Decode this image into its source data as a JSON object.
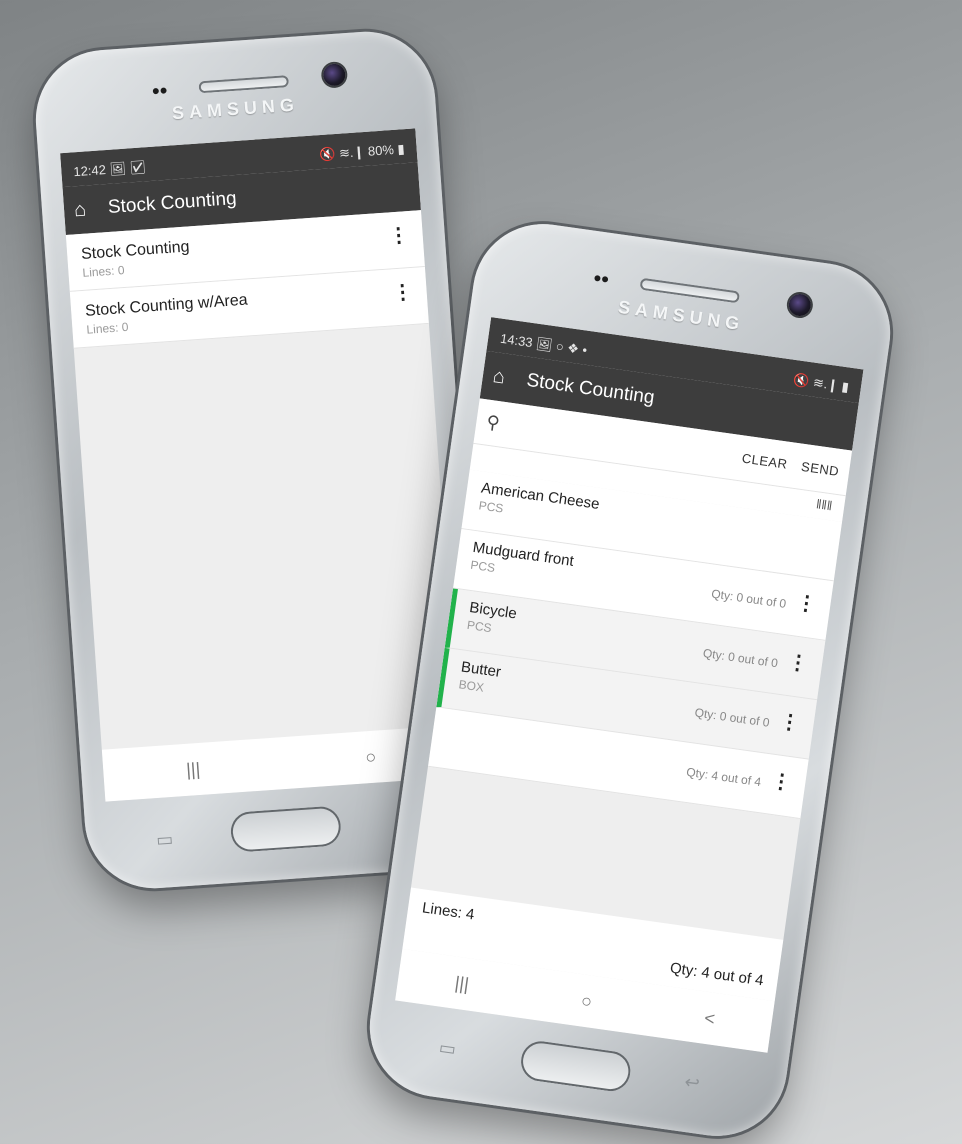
{
  "left_phone": {
    "brand": "SAMSUNG",
    "status": {
      "time": "12:42",
      "icons": "🖼 ☑",
      "right": "🔇 ≋.❙ 80% ▮"
    },
    "appbar": {
      "home_icon": "⌂",
      "title": "Stock Counting"
    },
    "items": [
      {
        "name": "Stock Counting",
        "sub": "Lines: 0"
      },
      {
        "name": "Stock Counting w/Area",
        "sub": "Lines: 0"
      }
    ],
    "navbar": {
      "recent": "|||",
      "home": "○"
    }
  },
  "right_phone": {
    "brand": "SAMSUNG",
    "status": {
      "time": "14:33",
      "icons": "🖼 ○ ❖ •",
      "right": "🔇 ≋.❙ ▮"
    },
    "appbar": {
      "home_icon": "⌂",
      "title": "Stock Counting"
    },
    "search": {
      "icon": "⚲",
      "placeholder": "",
      "clear": "CLEAR",
      "send": "SEND"
    },
    "barcode_icon": "‖‖‖",
    "lines": [
      {
        "name": "American Cheese",
        "unit": "PCS",
        "qty": "",
        "done": false
      },
      {
        "name": "Mudguard front",
        "unit": "PCS",
        "qty": "Qty: 0 out of 0",
        "done": false
      },
      {
        "name": "Bicycle",
        "unit": "PCS",
        "qty": "Qty: 0 out of 0",
        "done": true
      },
      {
        "name": "Butter",
        "unit": "BOX",
        "qty": "Qty: 0 out of 0",
        "done": true
      },
      {
        "name": "",
        "unit": "",
        "qty": "Qty: 4 out of 4",
        "done": false
      }
    ],
    "footer": {
      "lines": "Lines: 4",
      "total": "Qty: 4 out of 4"
    },
    "navbar": {
      "recent": "|||",
      "home": "○",
      "back": "<"
    }
  },
  "colors": {
    "appbar": "#3d3d3d",
    "done_accent": "#21b24b",
    "background": "#eeeeee"
  }
}
